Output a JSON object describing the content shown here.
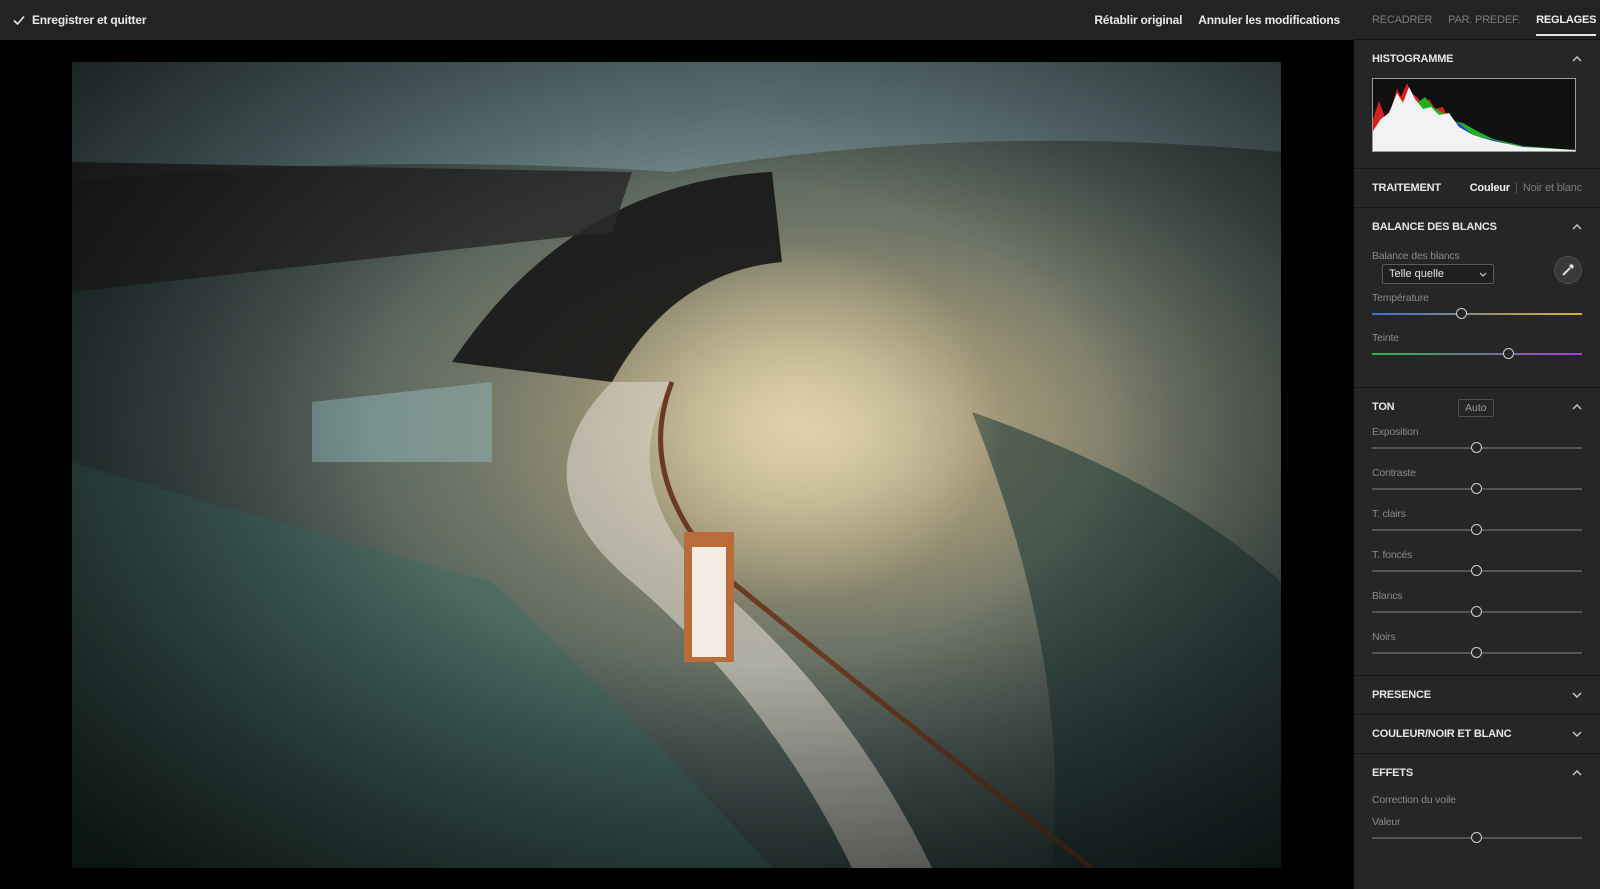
{
  "topbar": {
    "save_label": "Enregistrer et quitter",
    "reset_label": "Rétablir original",
    "undo_label": "Annuler les modifications"
  },
  "panel": {
    "tabs": [
      {
        "label": "RECADRER",
        "active": false
      },
      {
        "label": "PAR. PREDEF.",
        "active": false
      },
      {
        "label": "REGLAGES",
        "active": true
      }
    ],
    "histogram": {
      "title": "HISTOGRAMME"
    },
    "treatment": {
      "title": "TRAITEMENT",
      "color_label": "Couleur",
      "bw_label": "Noir et blanc",
      "selected": "Couleur"
    },
    "white_balance": {
      "title": "BALANCE DES BLANCS",
      "wb_label": "Balance des blancs",
      "wb_value": "Telle quelle",
      "temperature": {
        "label": "Température",
        "value": 0.43
      },
      "tint": {
        "label": "Teinte",
        "value": 0.65
      }
    },
    "tone": {
      "title": "TON",
      "auto_label": "Auto",
      "sliders": [
        {
          "label": "Exposition",
          "value": 0.5
        },
        {
          "label": "Contraste",
          "value": 0.5
        },
        {
          "label": "T. clairs",
          "value": 0.5
        },
        {
          "label": "T. foncés",
          "value": 0.5
        },
        {
          "label": "Blancs",
          "value": 0.5
        },
        {
          "label": "Noirs",
          "value": 0.5
        }
      ]
    },
    "presence": {
      "title": "PRESENCE"
    },
    "color_bw": {
      "title": "COULEUR/NOIR ET BLANC"
    },
    "effects": {
      "title": "EFFETS",
      "dehaze_label": "Correction du voile",
      "value_label": "Valeur",
      "value": 0.5
    }
  },
  "colors": {
    "temp_left": "#3a6fd8",
    "temp_right": "#e0b21c",
    "tint_left": "#2fb84a",
    "tint_right": "#a83ad8"
  }
}
